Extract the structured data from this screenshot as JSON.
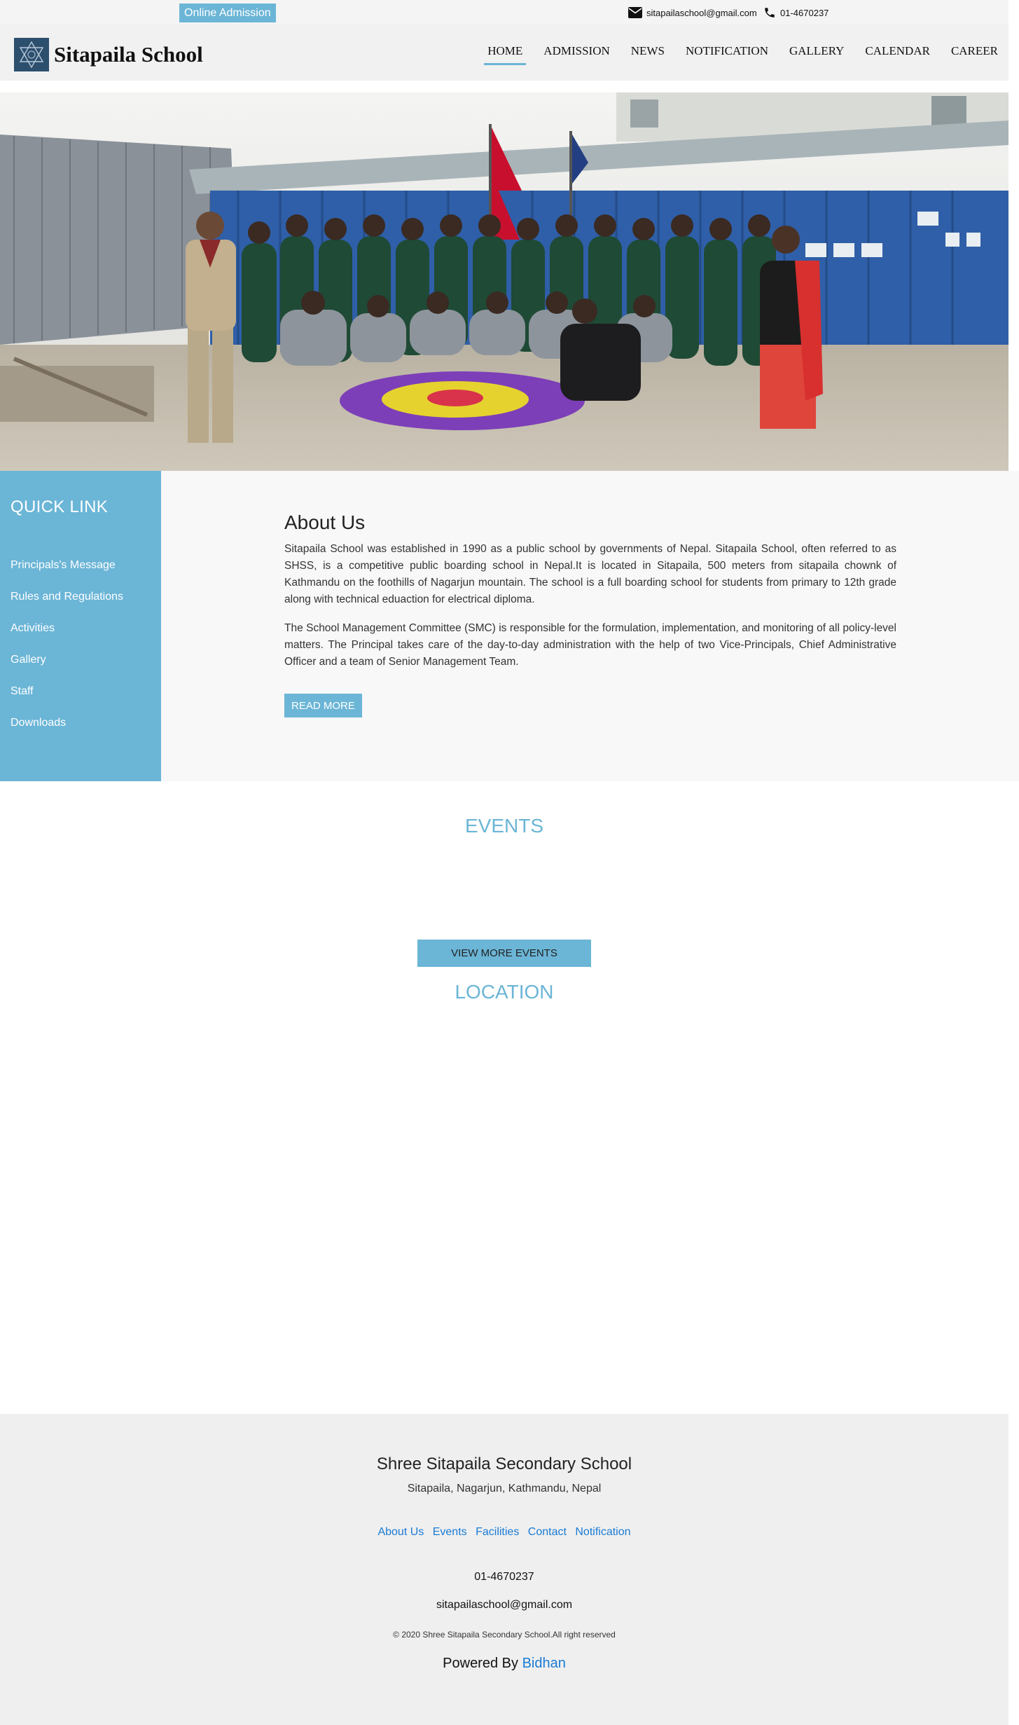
{
  "topbar": {
    "admission_label": "Online Admission",
    "email": "sitapailaschool@gmail.com",
    "phone": "01-4670237"
  },
  "header": {
    "title": "Sitapaila School",
    "nav": [
      "HOME",
      "ADMISSION",
      "NEWS",
      "NOTIFICATION",
      "GALLERY",
      "CALENDAR",
      "CAREER"
    ],
    "active_nav": "HOME"
  },
  "quick_link": {
    "title": "QUICK LINK",
    "items": [
      "Principals's Message",
      "Rules and Regulations",
      "Activities",
      "Gallery",
      "Staff",
      "Downloads"
    ]
  },
  "about": {
    "title": "About Us",
    "paragraphs": [
      "Sitapaila School was established in 1990 as a public school by governments of Nepal. Sitapaila School, often referred to as SHSS, is a competitive public boarding school in Nepal.It is located in Sitapaila, 500 meters from sitapaila chownk of Kathmandu on the foothills of Nagarjun mountain. The school is a full boarding school for students from primary to 12th grade along with technical eduaction for electrical diploma.",
      "The School Management Committee (SMC) is responsible for the formulation, implementation, and monitoring of all policy-level matters. The Principal takes care of the day-to-day administration with the help of two Vice-Principals, Chief Administrative Officer and a team of Senior Management Team."
    ],
    "read_more": "READ MORE"
  },
  "events": {
    "title": "EVENTS",
    "view_more": "VIEW MORE EVENTS"
  },
  "location": {
    "title": "LOCATION"
  },
  "footer": {
    "school_name": "Shree Sitapaila Secondary School",
    "address": "Sitapaila, Nagarjun, Kathmandu, Nepal",
    "links": [
      "About Us",
      "Events",
      "Facilities",
      "Contact",
      "Notification"
    ],
    "phone": "01-4670237",
    "email": "sitapailaschool@gmail.com",
    "copyright": "© 2020 Shree Sitapaila Secondary School.All right reserved",
    "powered_by": "Powered By",
    "powered_name": "Bidhan"
  },
  "colors": {
    "accent": "#6bb5d6",
    "link": "#1a7bd4"
  }
}
